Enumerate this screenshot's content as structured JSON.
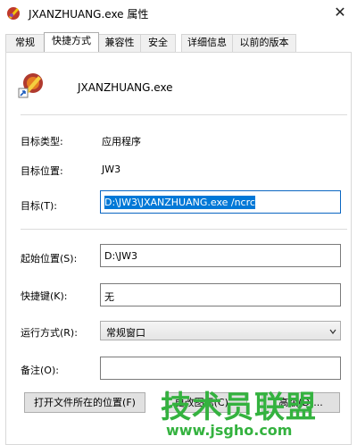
{
  "window": {
    "title": "JXANZHUANG.exe 属性",
    "close_glyph": "✕"
  },
  "tabs": [
    "常规",
    "快捷方式",
    "兼容性",
    "安全",
    "详细信息",
    "以前的版本"
  ],
  "active_tab": "快捷方式",
  "file_name": "JXANZHUANG.exe",
  "properties": {
    "target_type_label": "目标类型:",
    "target_type_value": "应用程序",
    "target_location_label": "目标位置:",
    "target_location_value": "JW3",
    "target_label": "目标(T):",
    "target_value": "D:\\JW3\\JXANZHUANG.exe /ncrc",
    "start_in_label": "起始位置(S):",
    "start_in_value": "D:\\JW3",
    "shortcut_key_label": "快捷键(K):",
    "shortcut_key_value": "无",
    "run_label": "运行方式(R):",
    "run_value": "常规窗口",
    "comment_label": "备注(O):",
    "comment_value": ""
  },
  "buttons": {
    "open_location": "打开文件所在的位置(F)",
    "change_icon": "更改图标(C)...",
    "advanced": "高级(D)..."
  },
  "watermark": {
    "title": "技术员联盟",
    "url": "www.jsgho.com"
  }
}
